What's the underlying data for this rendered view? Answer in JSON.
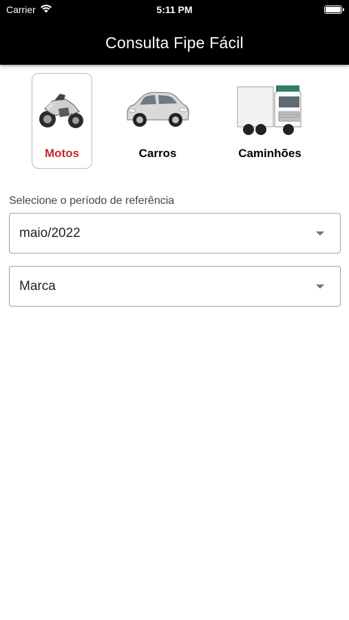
{
  "status_bar": {
    "carrier": "Carrier",
    "time": "5:11 PM",
    "wifi_icon": "wifi-icon",
    "battery_icon": "battery-icon"
  },
  "app_bar": {
    "title": "Consulta Fipe Fácil",
    "background": "#000000"
  },
  "vehicle_types": [
    {
      "label": "Motos",
      "icon": "motorcycle-icon",
      "selected": true
    },
    {
      "label": "Carros",
      "icon": "car-icon",
      "selected": false
    },
    {
      "label": "Caminhões",
      "icon": "truck-icon",
      "selected": false
    }
  ],
  "selected_color": "#c62828",
  "form": {
    "period_label": "Selecione o período de referência",
    "period_value": "maio/2022",
    "brand_value": "Marca"
  }
}
